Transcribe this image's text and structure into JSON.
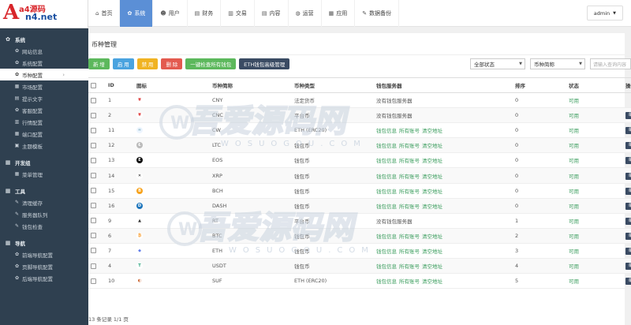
{
  "logo": {
    "big": "A",
    "line1": "a4源码",
    "line2": "n4.net"
  },
  "sidebar": {
    "groups": [
      {
        "label": "系统",
        "icon": "gear-icon",
        "items": [
          {
            "label": "网站信息",
            "icon": "gear-icon"
          },
          {
            "label": "系统配置",
            "icon": "gear-icon"
          },
          {
            "label": "币种配置",
            "icon": "coin-icon",
            "active": true
          },
          {
            "label": "市场配置",
            "icon": "grid-icon"
          },
          {
            "label": "提示文字",
            "icon": "doc-icon"
          },
          {
            "label": "客服配置",
            "icon": "gear-icon"
          },
          {
            "label": "行情配置",
            "icon": "chart-icon"
          },
          {
            "label": "端口配置",
            "icon": "grid-icon"
          },
          {
            "label": "主题模板",
            "icon": "layout-icon"
          }
        ]
      },
      {
        "label": "开发组",
        "icon": "grid-icon",
        "items": [
          {
            "label": "菜单管理",
            "icon": "grid-icon"
          }
        ]
      },
      {
        "label": "工具",
        "icon": "grid-icon",
        "items": [
          {
            "label": "清理缓存",
            "icon": "wrench-icon"
          },
          {
            "label": "服务器队列",
            "icon": "wrench-icon"
          },
          {
            "label": "钱包检查",
            "icon": "wrench-icon"
          }
        ]
      },
      {
        "label": "导航",
        "icon": "grid-icon",
        "items": [
          {
            "label": "前端导航配置",
            "icon": "gear-icon"
          },
          {
            "label": "页脚导航配置",
            "icon": "gear-icon"
          },
          {
            "label": "后端导航配置",
            "icon": "gear-icon"
          }
        ]
      }
    ],
    "active_arrow": "›"
  },
  "topbar": {
    "tabs": [
      {
        "label": "首页",
        "icon": "home-icon"
      },
      {
        "label": "系统",
        "icon": "gear-icon",
        "active": true
      },
      {
        "label": "用户",
        "icon": "user-icon"
      },
      {
        "label": "财务",
        "icon": "list-icon"
      },
      {
        "label": "交易",
        "icon": "bar-chart-icon"
      },
      {
        "label": "内容",
        "icon": "doc-icon"
      },
      {
        "label": "运营",
        "icon": "globe-icon"
      },
      {
        "label": "应用",
        "icon": "grid-icon"
      },
      {
        "label": "数据备份",
        "icon": "wrench-icon"
      }
    ],
    "user": "admin"
  },
  "page": {
    "title": "币种管理",
    "buttons": {
      "add": "新 增",
      "enable": "启 用",
      "disable": "禁 用",
      "delete": "删 除",
      "check_wallet": "一键检查所有钱包",
      "eth_wallet": "ETH钱包高级管理"
    },
    "status_select": "全部状态",
    "short_select": "币种简称",
    "search_placeholder": "请输入查询内容"
  },
  "table": {
    "headers": [
      "",
      "ID",
      "图标",
      "币种简称",
      "币种类型",
      "钱包服务器",
      "排序",
      "状态",
      "操作"
    ],
    "rows": [
      {
        "id": "1",
        "icon": "cny",
        "name": "CNY",
        "type": "法定货币",
        "wallet": "没有钱包服务器",
        "wallet_links": false,
        "sort": "0",
        "status": "可用",
        "edit": false
      },
      {
        "id": "2",
        "icon": "cnc",
        "name": "CNC",
        "type": "平台币",
        "wallet": "没有钱包服务器",
        "wallet_links": false,
        "sort": "0",
        "status": "可用",
        "edit": true
      },
      {
        "id": "11",
        "icon": "cw",
        "name": "CW",
        "type": "ETH (ERC20)",
        "wallet_links": true,
        "sort": "0",
        "status": "可用",
        "edit": true
      },
      {
        "id": "12",
        "icon": "ltc",
        "name": "LTC",
        "type": "钱包币",
        "wallet_links": true,
        "sort": "0",
        "status": "可用",
        "edit": true
      },
      {
        "id": "13",
        "icon": "eos",
        "name": "EOS",
        "type": "钱包币",
        "wallet_links": true,
        "sort": "0",
        "status": "可用",
        "edit": true
      },
      {
        "id": "14",
        "icon": "xrp",
        "name": "XRP",
        "type": "钱包币",
        "wallet_links": true,
        "sort": "0",
        "status": "可用",
        "edit": true
      },
      {
        "id": "15",
        "icon": "bch",
        "name": "BCH",
        "type": "钱包币",
        "wallet_links": true,
        "sort": "0",
        "status": "可用",
        "edit": true
      },
      {
        "id": "16",
        "icon": "dash",
        "name": "DASH",
        "type": "钱包币",
        "wallet_links": true,
        "sort": "0",
        "status": "可用",
        "edit": true
      },
      {
        "id": "9",
        "icon": "rt",
        "name": "RT",
        "type": "平台币",
        "wallet": "没有钱包服务器",
        "wallet_links": false,
        "sort": "1",
        "status": "可用",
        "edit": true
      },
      {
        "id": "6",
        "icon": "btc",
        "name": "BTC",
        "type": "钱包币",
        "wallet_links": true,
        "sort": "2",
        "status": "可用",
        "edit": true
      },
      {
        "id": "7",
        "icon": "eth",
        "name": "ETH",
        "type": "钱包币",
        "wallet_links": true,
        "sort": "3",
        "status": "可用",
        "edit": true
      },
      {
        "id": "4",
        "icon": "usdt",
        "name": "USDT",
        "type": "钱包币",
        "wallet_links": true,
        "sort": "4",
        "status": "可用",
        "edit": true
      },
      {
        "id": "10",
        "icon": "suf",
        "name": "SUF",
        "type": "ETH (ERC20)",
        "wallet_links": true,
        "sort": "5",
        "status": "可用",
        "edit": true
      }
    ],
    "link_labels": [
      "钱包信息",
      "所有账号",
      "清空地址"
    ],
    "edit_label": "编辑"
  },
  "footer": "13 条记录 1/1 页",
  "watermark": {
    "text": "吾爱源码网",
    "sub": "WOSUOGOU.COM"
  },
  "colors": {
    "sidebar": "#2f4050",
    "accent": "#5b8fd6",
    "green": "#5cb85c"
  }
}
